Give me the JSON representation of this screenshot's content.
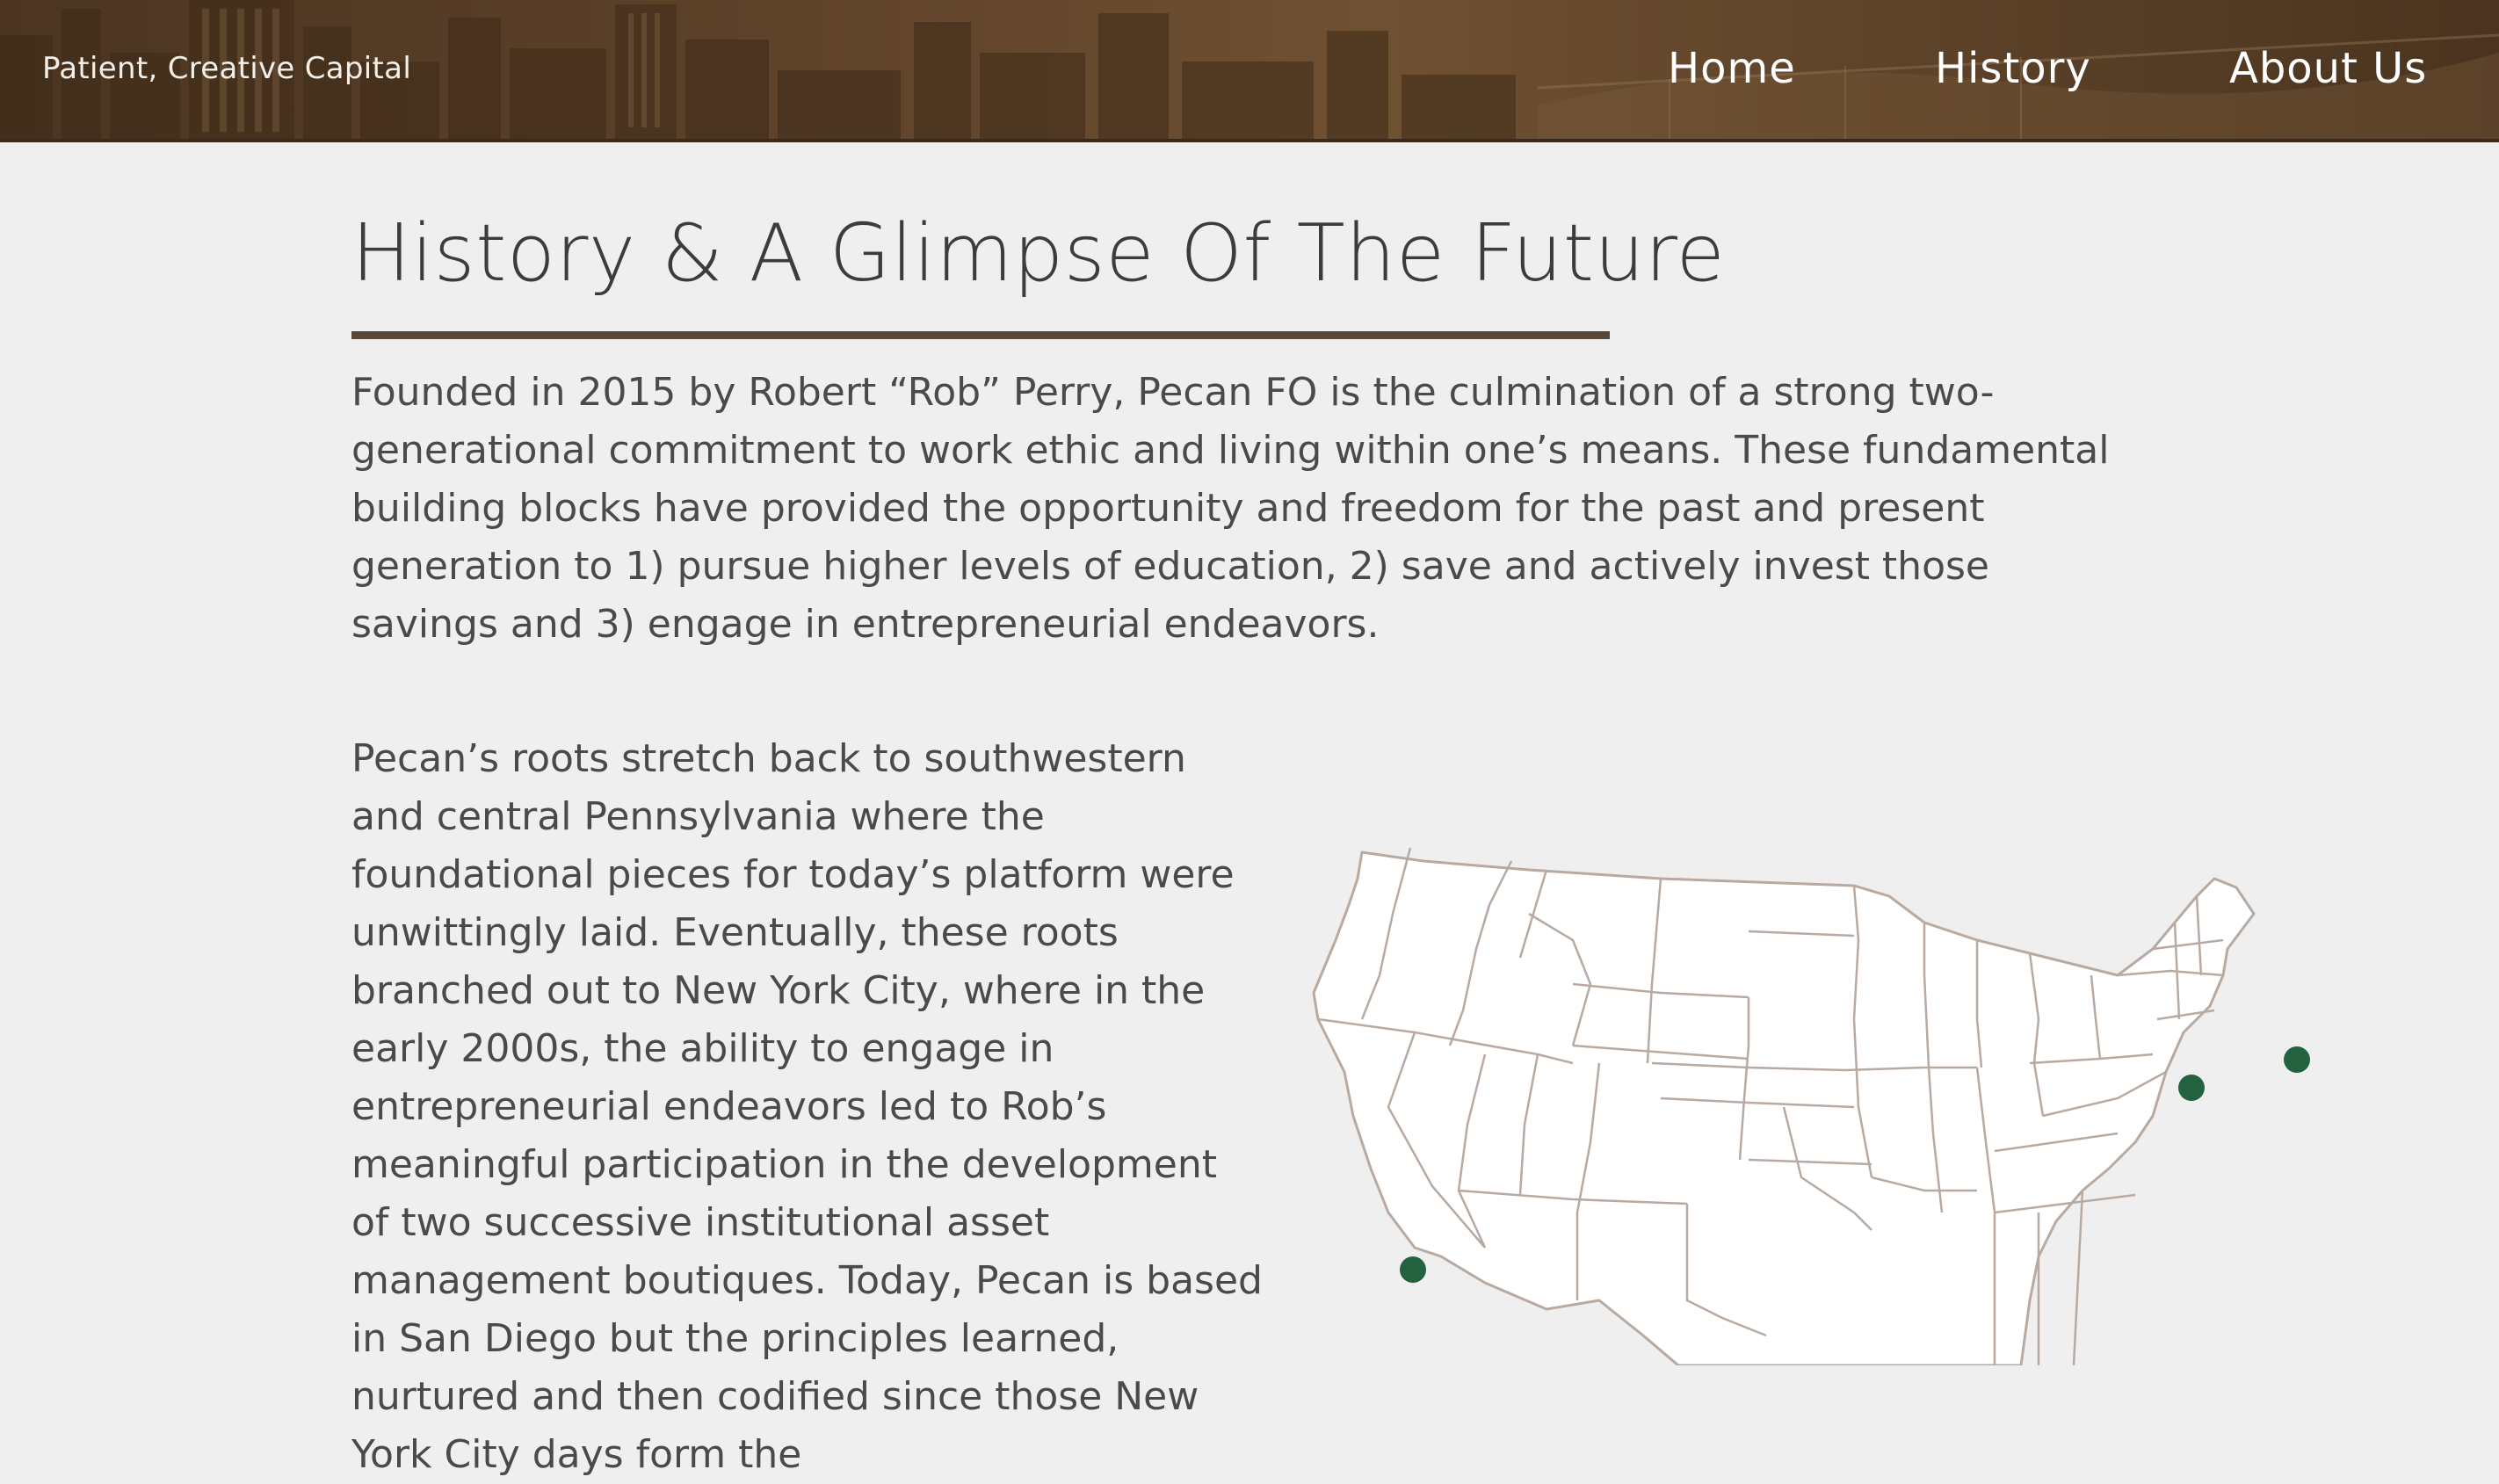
{
  "header": {
    "tagline": "Patient, Creative Capital",
    "nav": [
      {
        "label": "Home"
      },
      {
        "label": "History"
      },
      {
        "label": "About Us"
      }
    ]
  },
  "main": {
    "title": "History & A Glimpse Of The Future",
    "intro": "Founded in 2015 by Robert “Rob” Perry, Pecan FO is the culmination of a strong two-generational commitment to work ethic and living within one’s means. These fundamental building blocks have provided the opportunity and freedom for the past and present generation to 1) pursue higher levels of education, 2) save and actively invest those savings and 3) engage in entrepreneurial endeavors.",
    "roots": "Pecan’s roots stretch back to southwestern and central Pennsylvania where the foundational pieces for today’s platform were unwittingly laid. Eventually, these roots branched out to New York City, where in the early 2000s, the ability to engage in entrepreneurial endeavors led to Rob’s meaningful participation in the development of two successive institutional asset management boutiques. Today, Pecan is based in San Diego but the principles learned, nurtured and then codified since those New York City days form the"
  },
  "map": {
    "marker_color": "#23613f",
    "border_color": "#b8aaa0",
    "markers": [
      {
        "name": "San Diego"
      },
      {
        "name": "Pennsylvania"
      },
      {
        "name": "New York City"
      }
    ]
  },
  "colors": {
    "header_brown": "#5d4129",
    "rule_brown": "#5b4636",
    "background": "#efefef"
  }
}
